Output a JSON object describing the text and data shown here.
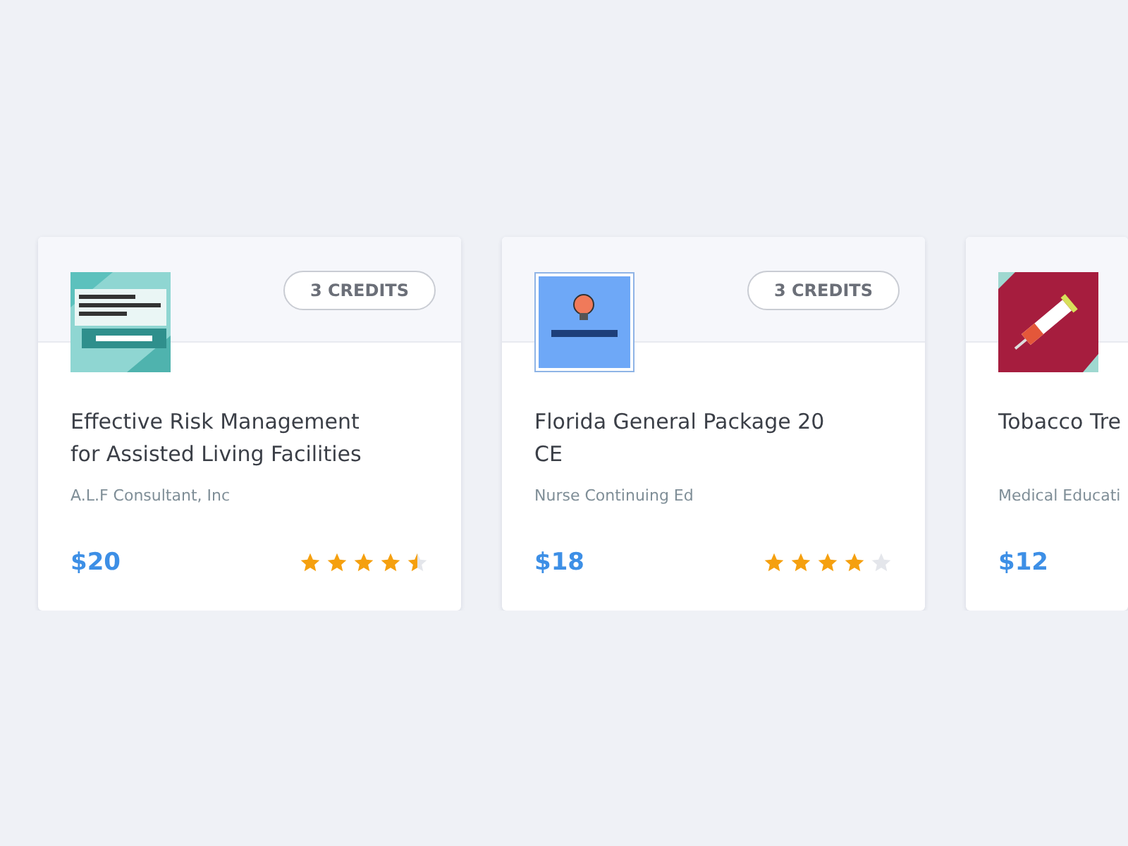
{
  "courses": [
    {
      "kind": "general",
      "credits": "3 CREDITS",
      "title": "Effective Risk Management for Assisted Living Facilities",
      "provider": "A.L.F Consultant, Inc",
      "price": "$20",
      "stars": 4.5
    },
    {
      "kind": "bulb",
      "credits": "3 CREDITS",
      "title": "Florida General Package 20 CE",
      "provider": "Nurse Continuing Ed",
      "price": "$18",
      "stars": 4
    },
    {
      "kind": "syringe",
      "title": "Tobacco Tre",
      "provider": "Medical Educati",
      "price": "$12"
    }
  ]
}
